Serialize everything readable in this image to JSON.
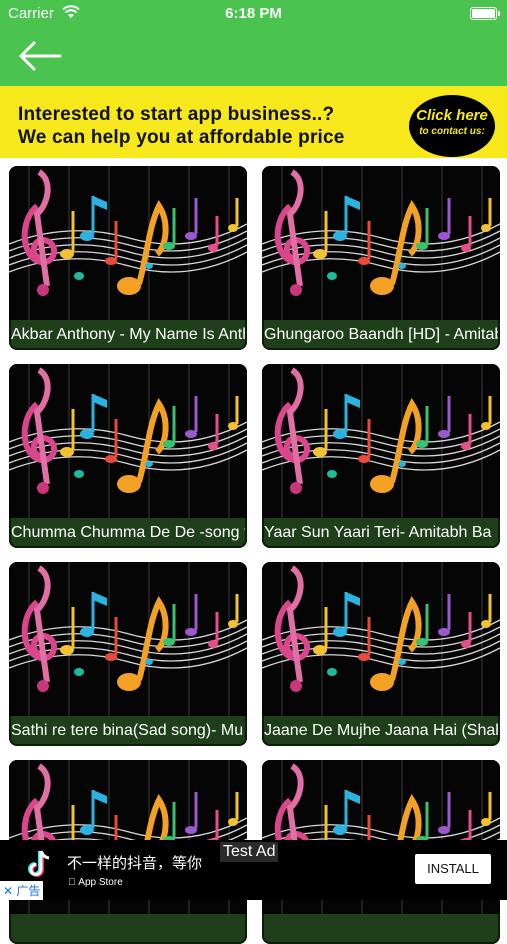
{
  "status_bar": {
    "carrier": "Carrier",
    "time": "6:18 PM"
  },
  "banner": {
    "line1": "Interested to start app business..?",
    "line2": "We can help you at affordable price",
    "cta_line1": "Click here",
    "cta_line2": "to contact us:"
  },
  "songs": [
    {
      "title": "Akbar Anthony - My Name Is Anthony"
    },
    {
      "title": "Ghungaroo Baandh [HD] - Amitabh"
    },
    {
      "title": "Chumma Chumma De De -song from"
    },
    {
      "title": "Yaar Sun Yaari Teri- Amitabh Ba"
    },
    {
      "title": "Sathi re tere bina(Sad song)- Mu"
    },
    {
      "title": "Jaane De Mujhe Jaana Hai (Shah"
    },
    {
      "title": ""
    },
    {
      "title": ""
    }
  ],
  "ad": {
    "text": "不一样的抖音，等你",
    "store": "App Store",
    "install_label": "INSTALL",
    "test_label": "Test Ad",
    "choices_label": "广告"
  },
  "colors": {
    "header": "#4ac34f",
    "banner": "#f6e81a",
    "title_bar": "#1f3f1a"
  }
}
